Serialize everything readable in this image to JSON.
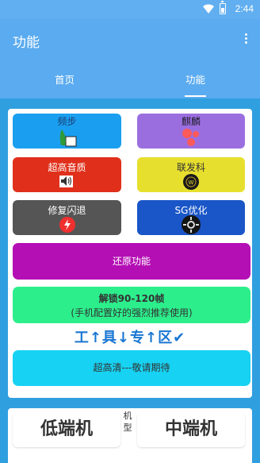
{
  "status": {
    "time": "2:44",
    "battery_glyph": "battery-icon"
  },
  "appbar": {
    "title": "功能"
  },
  "tabs": [
    {
      "label": "首页"
    },
    {
      "label": "功能"
    }
  ],
  "tiles": [
    {
      "label": "频步",
      "color": "#1a9ff0",
      "icon": "shoes-icon"
    },
    {
      "label": "麒麟",
      "color": "#9b6ee0",
      "icon": "molecule-icon"
    },
    {
      "label": "超高音质",
      "color": "#e0301b",
      "icon": "speaker-icon"
    },
    {
      "label": "联发科",
      "color": "#e7df2e",
      "icon": "mediatek-icon"
    },
    {
      "label": "修复闪退",
      "color": "#555555",
      "icon": "bolt-icon"
    },
    {
      "label": "SG优化",
      "color": "#1a56c8",
      "icon": "chip-icon"
    }
  ],
  "restore": {
    "label": "还原功能",
    "color": "#b40fb4"
  },
  "unlock": {
    "line1": "解锁90-120帧",
    "line2": "(手机配置好的强烈推荐使用)",
    "color": "#2cef8c"
  },
  "tools_heading": "工↑具↓专↑区✔",
  "ultra": {
    "label": "超高清---敬请期待",
    "color": "#17d2f2"
  },
  "devices": {
    "low": "低端机",
    "mid": "中端机",
    "type_label": "机型"
  }
}
